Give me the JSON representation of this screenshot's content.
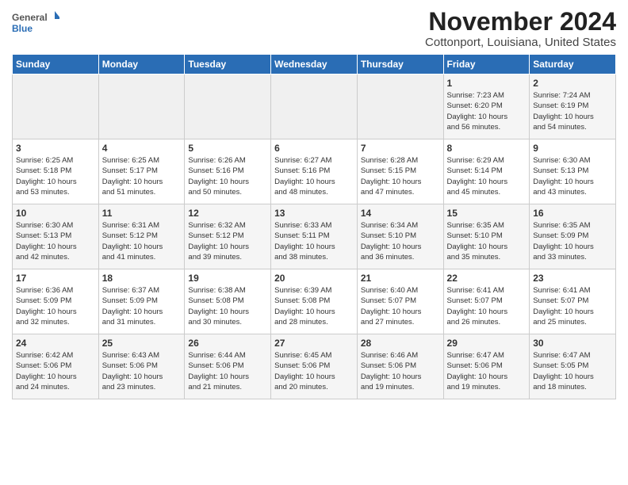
{
  "header": {
    "logo_line1": "General",
    "logo_line2": "Blue",
    "title": "November 2024",
    "subtitle": "Cottonport, Louisiana, United States"
  },
  "weekdays": [
    "Sunday",
    "Monday",
    "Tuesday",
    "Wednesday",
    "Thursday",
    "Friday",
    "Saturday"
  ],
  "weeks": [
    [
      {
        "day": "",
        "info": ""
      },
      {
        "day": "",
        "info": ""
      },
      {
        "day": "",
        "info": ""
      },
      {
        "day": "",
        "info": ""
      },
      {
        "day": "",
        "info": ""
      },
      {
        "day": "1",
        "info": "Sunrise: 7:23 AM\nSunset: 6:20 PM\nDaylight: 10 hours\nand 56 minutes."
      },
      {
        "day": "2",
        "info": "Sunrise: 7:24 AM\nSunset: 6:19 PM\nDaylight: 10 hours\nand 54 minutes."
      }
    ],
    [
      {
        "day": "3",
        "info": "Sunrise: 6:25 AM\nSunset: 5:18 PM\nDaylight: 10 hours\nand 53 minutes."
      },
      {
        "day": "4",
        "info": "Sunrise: 6:25 AM\nSunset: 5:17 PM\nDaylight: 10 hours\nand 51 minutes."
      },
      {
        "day": "5",
        "info": "Sunrise: 6:26 AM\nSunset: 5:16 PM\nDaylight: 10 hours\nand 50 minutes."
      },
      {
        "day": "6",
        "info": "Sunrise: 6:27 AM\nSunset: 5:16 PM\nDaylight: 10 hours\nand 48 minutes."
      },
      {
        "day": "7",
        "info": "Sunrise: 6:28 AM\nSunset: 5:15 PM\nDaylight: 10 hours\nand 47 minutes."
      },
      {
        "day": "8",
        "info": "Sunrise: 6:29 AM\nSunset: 5:14 PM\nDaylight: 10 hours\nand 45 minutes."
      },
      {
        "day": "9",
        "info": "Sunrise: 6:30 AM\nSunset: 5:13 PM\nDaylight: 10 hours\nand 43 minutes."
      }
    ],
    [
      {
        "day": "10",
        "info": "Sunrise: 6:30 AM\nSunset: 5:13 PM\nDaylight: 10 hours\nand 42 minutes."
      },
      {
        "day": "11",
        "info": "Sunrise: 6:31 AM\nSunset: 5:12 PM\nDaylight: 10 hours\nand 41 minutes."
      },
      {
        "day": "12",
        "info": "Sunrise: 6:32 AM\nSunset: 5:12 PM\nDaylight: 10 hours\nand 39 minutes."
      },
      {
        "day": "13",
        "info": "Sunrise: 6:33 AM\nSunset: 5:11 PM\nDaylight: 10 hours\nand 38 minutes."
      },
      {
        "day": "14",
        "info": "Sunrise: 6:34 AM\nSunset: 5:10 PM\nDaylight: 10 hours\nand 36 minutes."
      },
      {
        "day": "15",
        "info": "Sunrise: 6:35 AM\nSunset: 5:10 PM\nDaylight: 10 hours\nand 35 minutes."
      },
      {
        "day": "16",
        "info": "Sunrise: 6:35 AM\nSunset: 5:09 PM\nDaylight: 10 hours\nand 33 minutes."
      }
    ],
    [
      {
        "day": "17",
        "info": "Sunrise: 6:36 AM\nSunset: 5:09 PM\nDaylight: 10 hours\nand 32 minutes."
      },
      {
        "day": "18",
        "info": "Sunrise: 6:37 AM\nSunset: 5:09 PM\nDaylight: 10 hours\nand 31 minutes."
      },
      {
        "day": "19",
        "info": "Sunrise: 6:38 AM\nSunset: 5:08 PM\nDaylight: 10 hours\nand 30 minutes."
      },
      {
        "day": "20",
        "info": "Sunrise: 6:39 AM\nSunset: 5:08 PM\nDaylight: 10 hours\nand 28 minutes."
      },
      {
        "day": "21",
        "info": "Sunrise: 6:40 AM\nSunset: 5:07 PM\nDaylight: 10 hours\nand 27 minutes."
      },
      {
        "day": "22",
        "info": "Sunrise: 6:41 AM\nSunset: 5:07 PM\nDaylight: 10 hours\nand 26 minutes."
      },
      {
        "day": "23",
        "info": "Sunrise: 6:41 AM\nSunset: 5:07 PM\nDaylight: 10 hours\nand 25 minutes."
      }
    ],
    [
      {
        "day": "24",
        "info": "Sunrise: 6:42 AM\nSunset: 5:06 PM\nDaylight: 10 hours\nand 24 minutes."
      },
      {
        "day": "25",
        "info": "Sunrise: 6:43 AM\nSunset: 5:06 PM\nDaylight: 10 hours\nand 23 minutes."
      },
      {
        "day": "26",
        "info": "Sunrise: 6:44 AM\nSunset: 5:06 PM\nDaylight: 10 hours\nand 21 minutes."
      },
      {
        "day": "27",
        "info": "Sunrise: 6:45 AM\nSunset: 5:06 PM\nDaylight: 10 hours\nand 20 minutes."
      },
      {
        "day": "28",
        "info": "Sunrise: 6:46 AM\nSunset: 5:06 PM\nDaylight: 10 hours\nand 19 minutes."
      },
      {
        "day": "29",
        "info": "Sunrise: 6:47 AM\nSunset: 5:06 PM\nDaylight: 10 hours\nand 19 minutes."
      },
      {
        "day": "30",
        "info": "Sunrise: 6:47 AM\nSunset: 5:05 PM\nDaylight: 10 hours\nand 18 minutes."
      }
    ]
  ]
}
